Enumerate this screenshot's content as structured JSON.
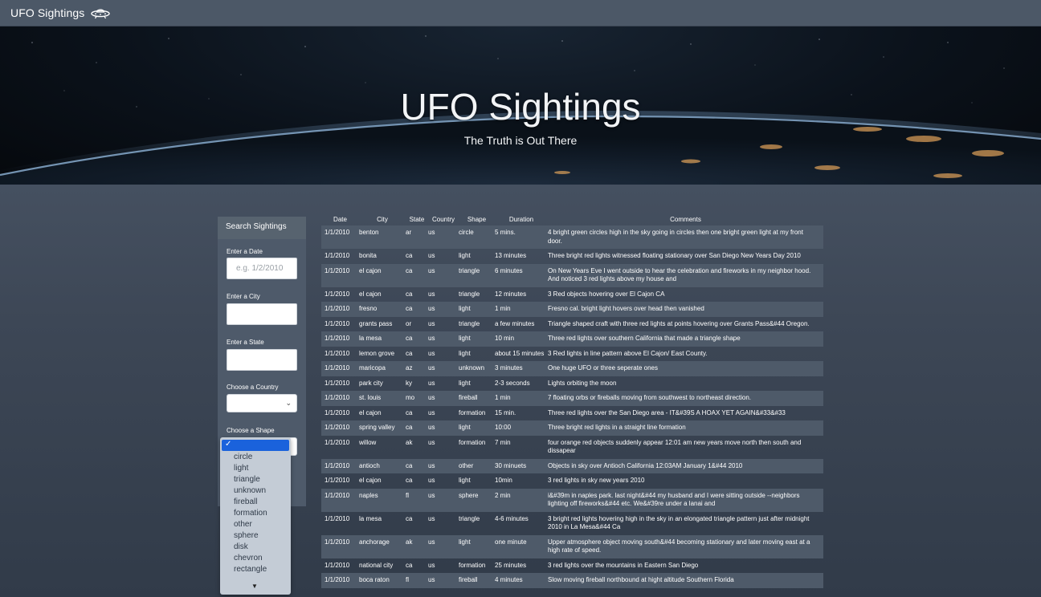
{
  "navbar": {
    "brand": "UFO Sightings",
    "icon": "ufo-icon"
  },
  "hero": {
    "title": "UFO Sightings",
    "subtitle": "The Truth is Out There"
  },
  "sidebar": {
    "title": "Search Sightings",
    "date_label": "Enter a Date",
    "date_placeholder": "e.g. 1/2/2010",
    "city_label": "Enter a City",
    "state_label": "Enter a State",
    "country_label": "Choose a Country",
    "shape_label": "Choose a Shape"
  },
  "shape_dropdown": {
    "options": [
      "circle",
      "light",
      "triangle",
      "unknown",
      "fireball",
      "formation",
      "other",
      "sphere",
      "disk",
      "chevron",
      "rectangle"
    ]
  },
  "table": {
    "headers": [
      "Date",
      "City",
      "State",
      "Country",
      "Shape",
      "Duration",
      "Comments"
    ],
    "rows": [
      [
        "1/1/2010",
        "benton",
        "ar",
        "us",
        "circle",
        "5 mins.",
        "4 bright green circles high in the sky going in circles then one bright green light at my front door."
      ],
      [
        "1/1/2010",
        "bonita",
        "ca",
        "us",
        "light",
        "13 minutes",
        "Three bright red lights witnessed floating stationary over San Diego New Years Day 2010"
      ],
      [
        "1/1/2010",
        "el cajon",
        "ca",
        "us",
        "triangle",
        "6 minutes",
        "On New Years Eve I went outside to hear the celebration and fireworks in my neighbor hood. And noticed 3 red lights above my house and"
      ],
      [
        "1/1/2010",
        "el cajon",
        "ca",
        "us",
        "triangle",
        "12 minutes",
        "3 Red objects hovering over El Cajon CA"
      ],
      [
        "1/1/2010",
        "fresno",
        "ca",
        "us",
        "light",
        "1 min",
        "Fresno cal. bright light hovers over head then vanished"
      ],
      [
        "1/1/2010",
        "grants pass",
        "or",
        "us",
        "triangle",
        "a few minutes",
        "Triangle shaped craft with three red lights at points hovering over Grants Pass&#44 Oregon."
      ],
      [
        "1/1/2010",
        "la mesa",
        "ca",
        "us",
        "light",
        "10 min",
        "Three red lights over southern California that made a triangle shape"
      ],
      [
        "1/1/2010",
        "lemon grove",
        "ca",
        "us",
        "light",
        "about 15 minutes",
        "3 Red lights in line pattern above El Cajon/ East County."
      ],
      [
        "1/1/2010",
        "maricopa",
        "az",
        "us",
        "unknown",
        "3 minutes",
        "One huge UFO or three seperate ones"
      ],
      [
        "1/1/2010",
        "park city",
        "ky",
        "us",
        "light",
        "2-3 seconds",
        "Lights orbiting the moon"
      ],
      [
        "1/1/2010",
        "st. louis",
        "mo",
        "us",
        "fireball",
        "1 min",
        "7 floating orbs or fireballs moving from southwest to northeast direction."
      ],
      [
        "1/1/2010",
        "el cajon",
        "ca",
        "us",
        "formation",
        "15 min.",
        "Three red lights over the San Diego area - IT&#39S A HOAX YET AGAIN&#33&#33"
      ],
      [
        "1/1/2010",
        "spring valley",
        "ca",
        "us",
        "light",
        "10:00",
        "Three bright red lights in a straight line formation"
      ],
      [
        "1/1/2010",
        "willow",
        "ak",
        "us",
        "formation",
        "7 min",
        "four orange red objects suddenly appear 12:01 am new years move north then south and dissapear"
      ],
      [
        "1/1/2010",
        "antioch",
        "ca",
        "us",
        "other",
        "30 minuets",
        "Objects in sky over Antioch California 12:03AM January 1&#44 2010"
      ],
      [
        "1/1/2010",
        "el cajon",
        "ca",
        "us",
        "light",
        "10min",
        "3 red lights in sky new years 2010"
      ],
      [
        "1/1/2010",
        "naples",
        "fl",
        "us",
        "sphere",
        "2 min",
        "i&#39m in naples park. last night&#44 my husband and I were sitting outside --neighbors lighting off fireworks&#44 etc. We&#39re under a lanai and"
      ],
      [
        "1/1/2010",
        "la mesa",
        "ca",
        "us",
        "triangle",
        "4-6 minutes",
        "3 bright red lights hovering high in the sky in an elongated triangle pattern just after midnight 2010 in La Mesa&#44 Ca"
      ],
      [
        "1/1/2010",
        "anchorage",
        "ak",
        "us",
        "light",
        "one minute",
        "Upper atmosphere object moving south&#44 becoming stationary and later moving east at a high rate of speed."
      ],
      [
        "1/1/2010",
        "national city",
        "ca",
        "us",
        "formation",
        "25 minutes",
        "3 red lights over the mountains in Eastern San Diego"
      ],
      [
        "1/1/2010",
        "boca raton",
        "fl",
        "us",
        "fireball",
        "4 minutes",
        "Slow moving fireball northbound at hight altitude Southern Florida"
      ]
    ]
  }
}
